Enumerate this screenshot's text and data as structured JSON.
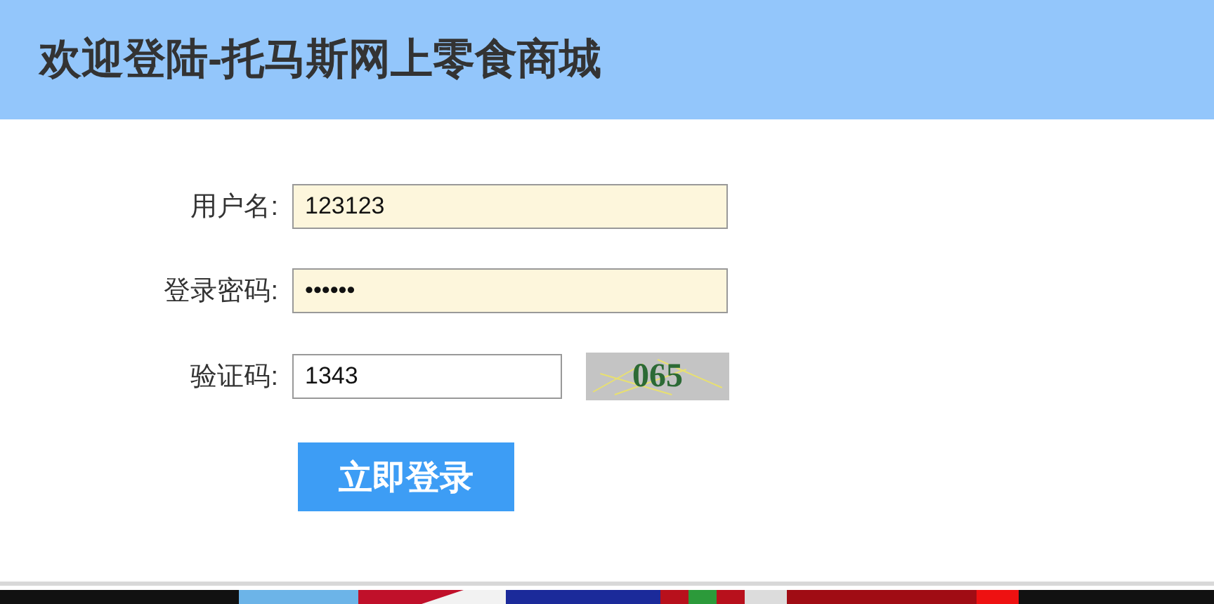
{
  "header": {
    "title": "欢迎登陆-托马斯网上零食商城"
  },
  "fields": [
    {
      "kind": "text",
      "label": "用户名:",
      "value": "123123"
    },
    {
      "kind": "text",
      "label": "登录密码:",
      "value": "••••••"
    },
    {
      "kind": "captcha",
      "label": "验证码:",
      "value": "1343",
      "captcha": "065"
    }
  ],
  "button": "立即登录"
}
